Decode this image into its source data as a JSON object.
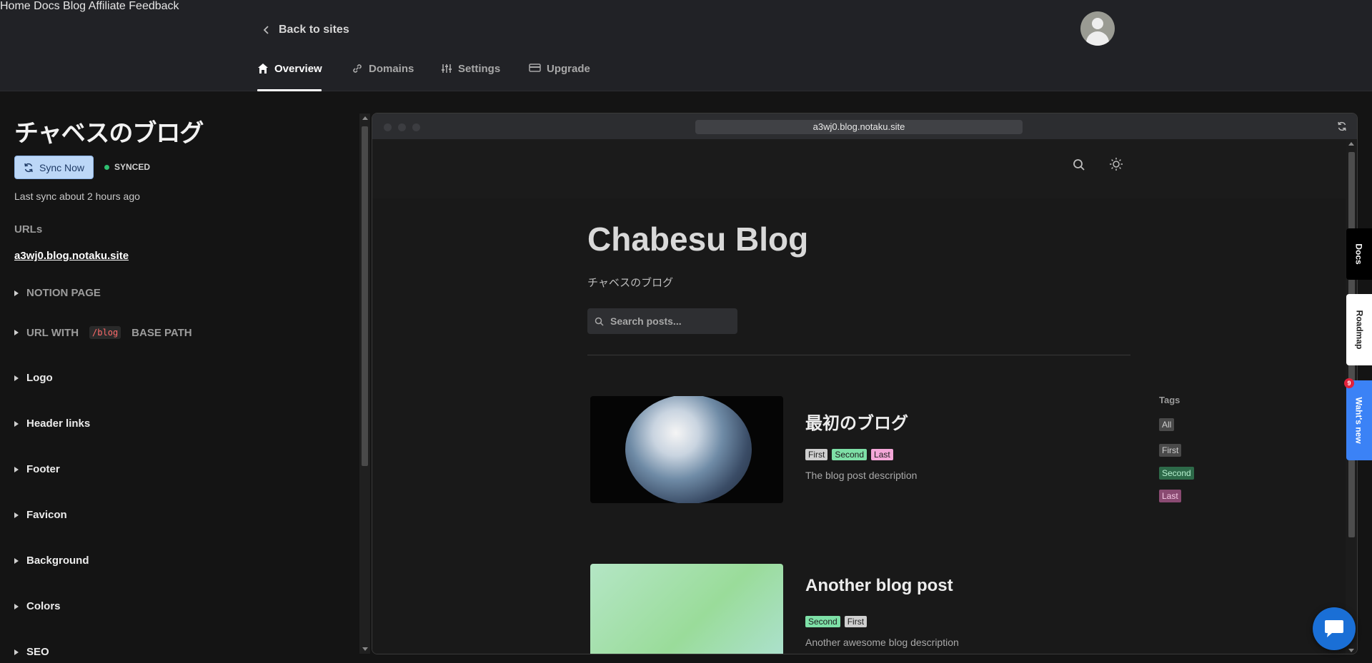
{
  "header": {
    "back_label": "Back to sites",
    "nav": [
      "Home",
      "Docs",
      "Blog",
      "Affiliate",
      "Feedback"
    ],
    "tabs": [
      "Overview",
      "Domains",
      "Settings",
      "Upgrade"
    ]
  },
  "sidebar": {
    "site_title": "チャベスのブログ",
    "sync_button": "Sync Now",
    "sync_status": "SYNCED",
    "last_sync": "Last sync about 2 hours ago",
    "urls_heading": "URLs",
    "url": "a3wj0.blog.notaku.site",
    "sections": {
      "notion_page": "NOTION PAGE",
      "url_with": "URL WITH",
      "code": "/blog",
      "base_path": "BASE PATH",
      "items": [
        "Logo",
        "Header links",
        "Footer",
        "Favicon",
        "Background",
        "Colors",
        "SEO"
      ]
    }
  },
  "preview": {
    "address": "a3wj0.blog.notaku.site",
    "blog_title": "Chabesu Blog",
    "blog_subtitle": "チャベスのブログ",
    "search_placeholder": "Search posts...",
    "posts": [
      {
        "title": "最初のブログ",
        "tags": [
          "First",
          "Second",
          "Last"
        ],
        "description": "The blog post description"
      },
      {
        "title": "Another blog post",
        "tags": [
          "Second",
          "First"
        ],
        "description": "Another awesome blog description"
      }
    ],
    "tags_heading": "Tags",
    "tags_list": [
      "All",
      "First",
      "Second",
      "Last"
    ]
  },
  "side_tabs": {
    "docs": "Docs",
    "roadmap": "Roadmap",
    "whats_new": "Waht's new",
    "badge": "9"
  },
  "colors": {
    "accent_blue": "#1a6fd6",
    "synced_green": "#2fbf71",
    "tag_second": "#7ee0a7",
    "tag_last": "#f4a7d8"
  }
}
